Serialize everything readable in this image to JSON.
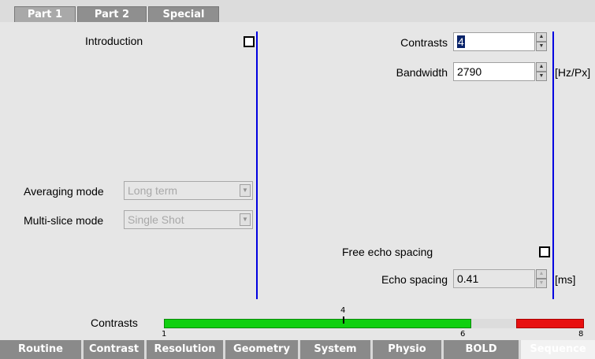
{
  "top_tabs": [
    {
      "label": "Part 1",
      "active": true
    },
    {
      "label": "Part 2",
      "active": false
    },
    {
      "label": "Special",
      "active": false
    }
  ],
  "left": {
    "introduction_label": "Introduction",
    "introduction_checked": false,
    "averaging_mode": {
      "label": "Averaging mode",
      "value": "Long term"
    },
    "multislice_mode": {
      "label": "Multi-slice mode",
      "value": "Single Shot"
    }
  },
  "right": {
    "contrasts": {
      "label": "Contrasts",
      "value": "4"
    },
    "bandwidth": {
      "label": "Bandwidth",
      "value": "2790",
      "unit": "[Hz/Px]"
    },
    "free_echo_spacing": {
      "label": "Free echo spacing",
      "checked": false
    },
    "echo_spacing": {
      "label": "Echo spacing",
      "value": "0.41",
      "unit": "[ms]"
    }
  },
  "contrast_bar": {
    "label": "Contrasts",
    "min": "1",
    "current": "4",
    "max_allowed": "6",
    "max": "8",
    "colors": {
      "valid": "#10d010",
      "gap": "#dcdcdc",
      "invalid": "#e81010"
    }
  },
  "bottom_tabs": [
    {
      "label": "Routine",
      "active": false
    },
    {
      "label": "Contrast",
      "active": false
    },
    {
      "label": "Resolution",
      "active": false
    },
    {
      "label": "Geometry",
      "active": false
    },
    {
      "label": "System",
      "active": false
    },
    {
      "label": "Physio",
      "active": false
    },
    {
      "label": "BOLD",
      "active": false
    },
    {
      "label": "Sequence",
      "active": true
    }
  ],
  "icons": {
    "spin_up": "spin-up-icon",
    "spin_down": "spin-down-icon",
    "dropdown": "chevron-down-icon"
  }
}
